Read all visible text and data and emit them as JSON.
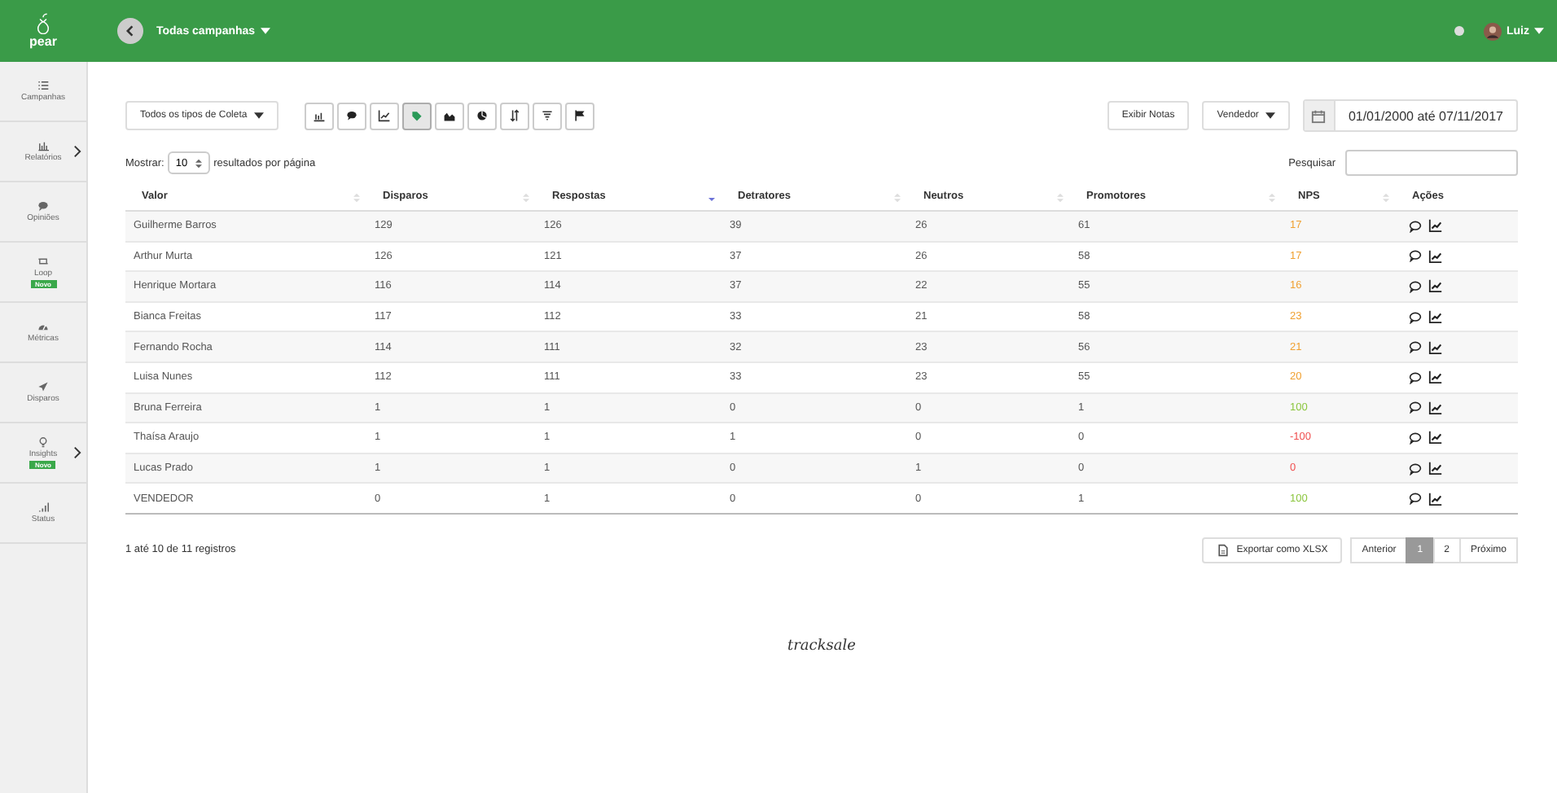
{
  "topbar": {
    "logo": "pear",
    "campaign": "Todas campanhas",
    "user": "Luiz"
  },
  "sidebar": {
    "items": [
      {
        "kind": "list",
        "label": "Campanhas",
        "submenu": false
      },
      {
        "kind": "bars",
        "label": "Relatórios",
        "submenu": true
      },
      {
        "kind": "comment",
        "label": "Opiniões",
        "submenu": false
      },
      {
        "kind": "loop",
        "label": "Loop",
        "badge": "Novo",
        "submenu": false
      },
      {
        "kind": "gauge",
        "label": "Métricas",
        "submenu": false
      },
      {
        "kind": "send",
        "label": "Disparos",
        "submenu": false
      },
      {
        "kind": "bulb",
        "label": "Insights",
        "badge": "Novo",
        "submenu": true
      },
      {
        "kind": "signal",
        "label": "Status",
        "submenu": false
      }
    ]
  },
  "toolbar": {
    "collect_type": "Todos os tipos de Coleta",
    "views": [
      {
        "kind": "bar",
        "selected": false
      },
      {
        "kind": "comment",
        "selected": false
      },
      {
        "kind": "line",
        "selected": false
      },
      {
        "kind": "tag",
        "selected": true
      },
      {
        "kind": "area",
        "selected": false
      },
      {
        "kind": "pie",
        "selected": false
      },
      {
        "kind": "sort",
        "selected": false
      },
      {
        "kind": "filter",
        "selected": false
      },
      {
        "kind": "flag",
        "selected": false
      }
    ],
    "notes_button": "Exibir Notas",
    "group_by": "Vendedor",
    "date_range": "01/01/2000 até 07/11/2017"
  },
  "table": {
    "length_label": "Mostrar:",
    "length_value": "10",
    "length_suffix": "resultados por página",
    "search_label": "Pesquisar",
    "columns": [
      {
        "label": "Valor",
        "sortable": true,
        "sorted": false
      },
      {
        "label": "Disparos",
        "sortable": true,
        "sorted": false
      },
      {
        "label": "Respostas",
        "sortable": true,
        "sorted": true
      },
      {
        "label": "Detratores",
        "sortable": true,
        "sorted": false
      },
      {
        "label": "Neutros",
        "sortable": true,
        "sorted": false
      },
      {
        "label": "Promotores",
        "sortable": true,
        "sorted": false
      },
      {
        "label": "NPS",
        "sortable": true,
        "sorted": false
      },
      {
        "label": "Ações",
        "sortable": false
      }
    ],
    "rows": [
      {
        "cells": [
          "Guilherme Barros",
          "129",
          "126",
          "39",
          "26",
          "61",
          "17"
        ],
        "color": "#f0a030"
      },
      {
        "cells": [
          "Arthur Murta",
          "126",
          "121",
          "37",
          "26",
          "58",
          "17"
        ],
        "color": "#f0a030"
      },
      {
        "cells": [
          "Henrique Mortara",
          "116",
          "114",
          "37",
          "22",
          "55",
          "16"
        ],
        "color": "#f0a030"
      },
      {
        "cells": [
          "Bianca Freitas",
          "117",
          "112",
          "33",
          "21",
          "58",
          "23"
        ],
        "color": "#f0a030"
      },
      {
        "cells": [
          "Fernando Rocha",
          "114",
          "111",
          "32",
          "23",
          "56",
          "21"
        ],
        "color": "#f0a030"
      },
      {
        "cells": [
          "Luisa Nunes",
          "112",
          "111",
          "33",
          "23",
          "55",
          "20"
        ],
        "color": "#f0a030"
      },
      {
        "cells": [
          "Bruna Ferreira",
          "1",
          "1",
          "0",
          "0",
          "1",
          "100"
        ],
        "color": "#8cc63f"
      },
      {
        "cells": [
          "Thaísa Araujo",
          "1",
          "1",
          "1",
          "0",
          "0",
          "-100"
        ],
        "color": "#f05050"
      },
      {
        "cells": [
          "Lucas Prado",
          "1",
          "1",
          "0",
          "1",
          "0",
          "0"
        ],
        "color": "#f05050"
      },
      {
        "cells": [
          "VENDEDOR",
          "0",
          "1",
          "0",
          "0",
          "1",
          "100"
        ],
        "color": "#8cc63f"
      }
    ],
    "info": "1 até 10 de 11 registros",
    "export_button": "Exportar como XLSX",
    "pagination": [
      {
        "label": "Anterior",
        "selected": false
      },
      {
        "label": "1",
        "selected": true
      },
      {
        "label": "2",
        "selected": false
      },
      {
        "label": "Próximo",
        "selected": false
      }
    ]
  },
  "footer": {
    "brand": "tracksale"
  }
}
